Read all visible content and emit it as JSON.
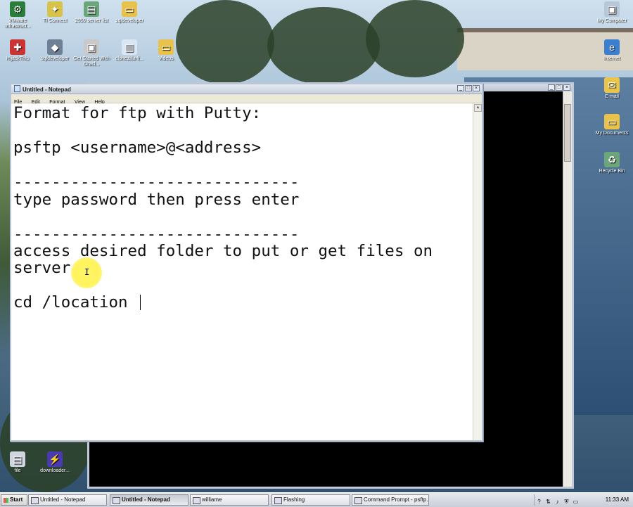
{
  "desktop": {
    "icons_left": [
      {
        "label": "VMware Infrastruct...",
        "glyph": "⚙",
        "color": "#2a7d3a"
      },
      {
        "label": "TI Connect",
        "glyph": "✦",
        "color": "#d8c34a"
      },
      {
        "label": "2650 server list",
        "glyph": "▤",
        "color": "#6aa67a"
      },
      {
        "label": "sqldeveloper",
        "glyph": "▭",
        "color": "#e8c24a"
      },
      {
        "label": "HijackThis",
        "glyph": "✚",
        "color": "#cc3333"
      },
      {
        "label": "sqldeveloper",
        "glyph": "◆",
        "color": "#6f7f95"
      },
      {
        "label": "Get Started With Oracl...",
        "glyph": "▣",
        "color": "#c9c9c9"
      },
      {
        "label": "clonezilla-li...",
        "glyph": "▥",
        "color": "#d9e6f3"
      },
      {
        "label": "Videos",
        "glyph": "▭",
        "color": "#e8c24a"
      }
    ],
    "icons_right": [
      {
        "label": "My Computer",
        "glyph": "▣",
        "color": "#b8c7d8"
      },
      {
        "label": "Internet",
        "glyph": "e",
        "color": "#3a7fd0"
      },
      {
        "label": "E-mail",
        "glyph": "✉",
        "color": "#e9c64a"
      },
      {
        "label": "My Documents",
        "glyph": "▭",
        "color": "#e8c24a"
      },
      {
        "label": "Recycle Bin",
        "glyph": "♻",
        "color": "#6aa67a"
      }
    ],
    "icons_bottom": [
      {
        "label": "file",
        "glyph": "▤",
        "color": "#d0d6de"
      },
      {
        "label": "downloader...",
        "glyph": "⚡",
        "color": "#4a3ab0"
      }
    ]
  },
  "notepad": {
    "title": "Untitled - Notepad",
    "menus": [
      "File",
      "Edit",
      "Format",
      "View",
      "Help"
    ],
    "lines": [
      "Format for ftp with Putty:",
      "",
      "psftp <username>@<address>",
      "",
      "------------------------------",
      "type password then press enter",
      "",
      "------------------------------",
      "access desired folder to put or get files on",
      "server",
      "",
      "cd /location "
    ]
  },
  "cmd_window": {
    "background": "#000000"
  },
  "taskbar": {
    "start_label": "Start",
    "tasks": [
      {
        "label": "Untitled - Notepad",
        "active": false
      },
      {
        "label": "Untitled - Notepad",
        "active": true
      },
      {
        "label": "williame",
        "active": false
      },
      {
        "label": "Flashing",
        "active": false
      },
      {
        "label": "Command Prompt - psftp...",
        "active": false
      }
    ],
    "clock": "11:33 AM"
  }
}
